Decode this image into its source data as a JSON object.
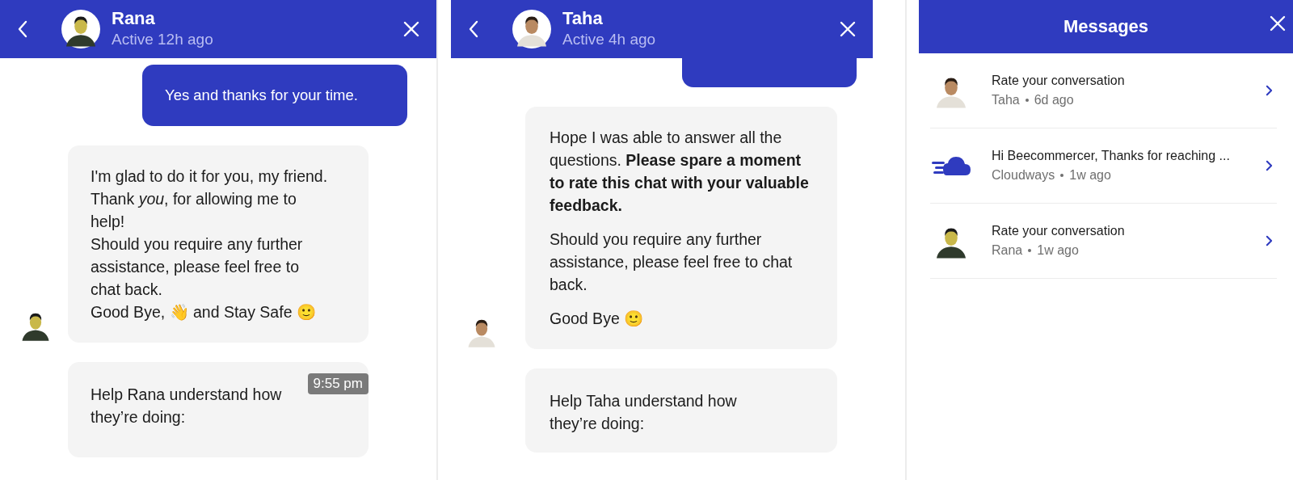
{
  "conversations": [
    {
      "header": {
        "name": "Rana",
        "status": "Active 12h ago"
      },
      "messages": [
        {
          "kind": "outgoing",
          "paragraphs": [
            "Yes and thanks for your time."
          ]
        },
        {
          "kind": "incoming",
          "show_avatar": true,
          "lines": [
            "I'm glad to do it for you, my friend.",
            "Thank *you*, for allowing me to help!",
            "Should you require any further assistance, please feel free to chat back.",
            "Good Bye, 👋 and Stay Safe 🙂"
          ]
        },
        {
          "kind": "incoming",
          "show_avatar": false,
          "paragraphs": [
            "Help Rana understand how they’re doing:"
          ],
          "timestamp": "9:55 pm"
        }
      ]
    },
    {
      "header": {
        "name": "Taha",
        "status": "Active 4h ago"
      },
      "messages": [
        {
          "kind": "outgoing"
        },
        {
          "kind": "incoming",
          "show_avatar": true,
          "paragraphs": [
            "Hope I was able to answer all the questions. **Please spare a moment to rate this chat with your valuable feedback.**",
            "Should you require any further assistance, please feel free to chat back.",
            "Good Bye 🙂"
          ]
        },
        {
          "kind": "incoming",
          "show_avatar": false,
          "paragraphs": [
            "Help Taha understand how they’re doing:"
          ]
        }
      ]
    }
  ],
  "inbox": {
    "title": "Messages",
    "items": [
      {
        "kind": "person",
        "title": "Rate your conversation",
        "sender": "Taha",
        "time": "6d ago"
      },
      {
        "kind": "brand",
        "title": "Hi Beecommercer, Thanks for reaching ...",
        "sender": "Cloudways",
        "time": "1w ago"
      },
      {
        "kind": "person",
        "title": "Rate your conversation",
        "sender": "Rana",
        "time": "1w ago"
      }
    ]
  }
}
